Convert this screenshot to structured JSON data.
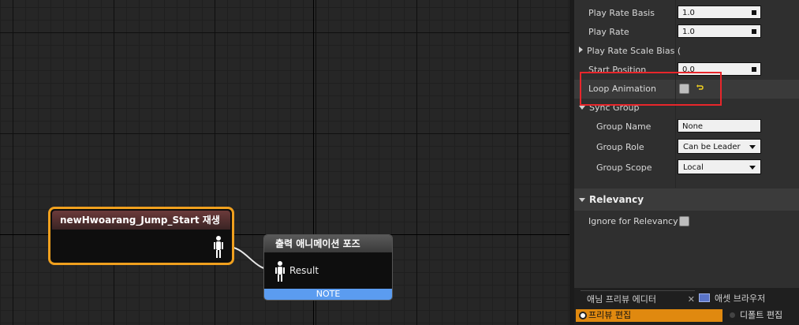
{
  "graph": {
    "play_node": {
      "title": "newHwoarang_Jump_Start 재생"
    },
    "output_node": {
      "title": "출력 애니메이션 포즈",
      "pin_label": "Result",
      "note": "NOTE"
    }
  },
  "details": {
    "rows": {
      "play_rate_basis": {
        "label": "Play Rate Basis",
        "value": "1.0"
      },
      "play_rate": {
        "label": "Play Rate",
        "value": "1.0"
      },
      "play_rate_scale_bias": {
        "label": "Play Rate Scale Bias ("
      },
      "start_position": {
        "label": "Start Position",
        "value": "0.0"
      },
      "loop_animation": {
        "label": "Loop Animation",
        "checked": false
      },
      "sync_group": {
        "label": "Sync Group"
      },
      "group_name": {
        "label": "Group Name",
        "value": "None"
      },
      "group_role": {
        "label": "Group Role",
        "value": "Can be Leader"
      },
      "group_scope": {
        "label": "Group Scope",
        "value": "Local"
      }
    },
    "relevancy": {
      "title": "Relevancy",
      "ignore_label": "Ignore for Relevancy T",
      "ignore_checked": false
    }
  },
  "bottom": {
    "tabs": [
      "애님 프리뷰 에디터",
      "애셋 브라우저"
    ],
    "close_glyph": "✕",
    "modes": [
      "프리뷰 편집",
      "디폴트 편집"
    ]
  },
  "colors": {
    "node_selected_border": "#f0a01e",
    "note_bar": "#5b9cf0",
    "highlight_box": "#e8262b",
    "active_mode": "#e0890f"
  }
}
